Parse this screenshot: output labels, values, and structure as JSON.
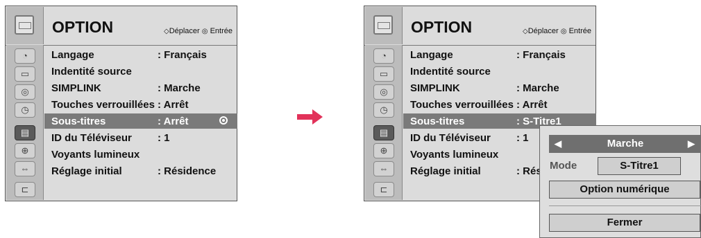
{
  "left_menu": {
    "title": "OPTION",
    "hint_move": "Déplacer",
    "hint_enter": "Entrée",
    "items": [
      {
        "label": "Langage",
        "value": ": Français"
      },
      {
        "label": "Indentité source",
        "value": ""
      },
      {
        "label": "SIMPLINK",
        "value": ": Marche"
      },
      {
        "label": "Touches verrouillées",
        "value": ": Arrêt"
      },
      {
        "label": "Sous-titres",
        "value": ": Arrêt"
      },
      {
        "label": "ID du Téléviseur",
        "value": ": 1"
      },
      {
        "label": "Voyants lumineux",
        "value": ""
      },
      {
        "label": "Réglage initial",
        "value": ": Résidence"
      }
    ]
  },
  "right_menu": {
    "title": "OPTION",
    "hint_move": "Déplacer",
    "hint_enter": "Entrée",
    "items": [
      {
        "label": "Langage",
        "value": ": Français"
      },
      {
        "label": "Indentité source",
        "value": ""
      },
      {
        "label": "SIMPLINK",
        "value": ": Marche"
      },
      {
        "label": "Touches verrouillées",
        "value": ": Arrêt"
      },
      {
        "label": "Sous-titres",
        "value": ": S-Titre1"
      },
      {
        "label": "ID du Téléviseur",
        "value": ": 1"
      },
      {
        "label": "Voyants lumineux",
        "value": ""
      },
      {
        "label": "Réglage initial",
        "value": ": Rés"
      }
    ]
  },
  "popup": {
    "toggle_value": "Marche",
    "mode_label": "Mode",
    "mode_value": "S-Titre1",
    "digital_option": "Option numérique",
    "close": "Fermer"
  },
  "icons": {
    "header": "screen-icon",
    "side": [
      "picture-icon",
      "screen-icon",
      "audio-icon",
      "time-icon",
      "option-icon",
      "lock-icon",
      "input-icon",
      "usb-icon"
    ]
  },
  "colors": {
    "selection": "#7a7a7a",
    "arrow": "#e2325a"
  }
}
